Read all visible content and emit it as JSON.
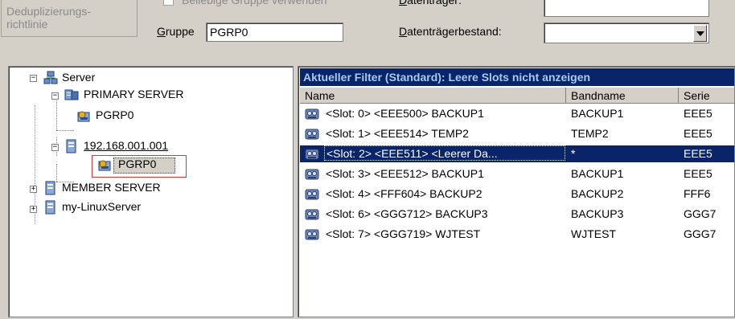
{
  "top": {
    "dedup_button": [
      "Deduplizierungs-",
      "richtlinie"
    ],
    "any_group_checkbox_label": "Beliebige Gruppe verwenden",
    "group_label_underlined": "G",
    "group_label_rest": "ruppe",
    "group_value": "PGRP0",
    "media_label_underlined": "D",
    "media_label_rest": "atenträger:",
    "media_value": "",
    "media_pool_label_underlined": "D",
    "media_pool_label_rest": "atenträgerbestand:",
    "media_pool_value": ""
  },
  "tree": {
    "items": [
      {
        "label": "Server",
        "icon": "server-group-icon",
        "expander": "−"
      },
      {
        "label": "PRIMARY SERVER",
        "icon": "primary-server-icon",
        "expander": "−"
      },
      {
        "label": "PGRP0",
        "icon": "tape-library-icon"
      },
      {
        "label": "192.168.001.001",
        "icon": "server-icon",
        "expander": "−"
      },
      {
        "label": "PGRP0",
        "icon": "tape-library-icon"
      },
      {
        "label": "MEMBER SERVER",
        "icon": "server-icon",
        "expander": "+"
      },
      {
        "label": "my-LinuxServer",
        "icon": "server-icon",
        "expander": "+"
      }
    ]
  },
  "list": {
    "title": "Aktueller Filter (Standard): Leere Slots nicht anzeigen",
    "columns": [
      "Name",
      "Bandname",
      "Serie"
    ],
    "rows": [
      {
        "name": "<Slot:  0> <EEE500> BACKUP1",
        "band": "BACKUP1",
        "serie": "EEE5"
      },
      {
        "name": "<Slot:  1> <EEE514> TEMP2",
        "band": "TEMP2",
        "serie": "EEE5"
      },
      {
        "name": "<Slot:  2> <EEE511> <Leerer Da...",
        "band": "*",
        "serie": "EEE5"
      },
      {
        "name": "<Slot:  3> <EEE512> BACKUP1",
        "band": "BACKUP1",
        "serie": "EEE5"
      },
      {
        "name": "<Slot:  4> <FFF604> BACKUP2",
        "band": "BACKUP2",
        "serie": "FFF6"
      },
      {
        "name": "<Slot:  6> <GGG712> BACKUP3",
        "band": "BACKUP3",
        "serie": "GGG7"
      },
      {
        "name": "<Slot:  7> <GGG719> WJTEST",
        "band": "WJTEST",
        "serie": "GGG7"
      }
    ]
  },
  "colors": {
    "selection": "#0a246a",
    "title_text": "#a6caf0",
    "highlight_box": "#e03030"
  }
}
